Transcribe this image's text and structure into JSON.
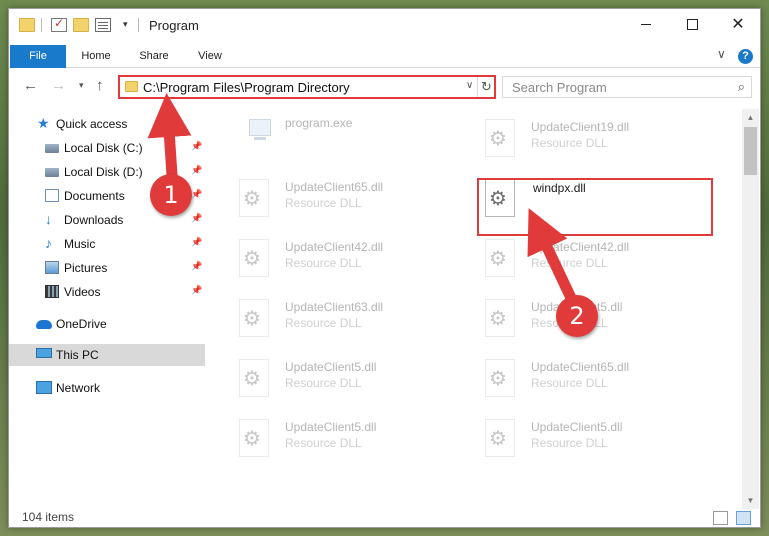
{
  "titlebar": {
    "title": "Program",
    "window_controls": [
      "minimize",
      "maximize",
      "close"
    ],
    "close_glyph": "✕"
  },
  "ribbon": {
    "tabs": [
      "File",
      "Home",
      "Share",
      "View"
    ],
    "help_glyph": "?",
    "expand_glyph": "∨"
  },
  "nav": {
    "back": "←",
    "forward": "→",
    "recent": "▾",
    "up": "↑",
    "address_path": "C:\\Program Files\\Program Directory",
    "address_dropdown": "∨",
    "refresh_glyph": "↻",
    "search_placeholder": "Search Program",
    "search_glyph": "⌕"
  },
  "sidebar": {
    "items": [
      {
        "label": "Quick access",
        "icon": "star-icon",
        "pinned": false
      },
      {
        "label": "Local Disk (C:)",
        "icon": "drive-icon",
        "pinned": true
      },
      {
        "label": "Local Disk (D:)",
        "icon": "drive-icon",
        "pinned": true
      },
      {
        "label": "Documents",
        "icon": "documents-icon",
        "pinned": true
      },
      {
        "label": "Downloads",
        "icon": "download-arrow-icon",
        "pinned": true
      },
      {
        "label": "Music",
        "icon": "music-note-icon",
        "pinned": true
      },
      {
        "label": "Pictures",
        "icon": "pictures-icon",
        "pinned": true
      },
      {
        "label": "Videos",
        "icon": "film-strip-icon",
        "pinned": true
      },
      {
        "label": "OneDrive",
        "icon": "cloud-icon",
        "pinned": false
      },
      {
        "label": "This PC",
        "icon": "computer-icon",
        "pinned": false,
        "selected": true
      },
      {
        "label": "Network",
        "icon": "network-icon",
        "pinned": false
      }
    ],
    "pin_glyph": "📌"
  },
  "files": [
    {
      "name": "program.exe",
      "type": "",
      "icon": "application-icon"
    },
    {
      "name": "UpdateClient19.dll",
      "type": "Resource DLL",
      "icon": "dll-gear-icon"
    },
    {
      "name": "UpdateClient65.dll",
      "type": "Resource DLL",
      "icon": "dll-gear-icon"
    },
    {
      "name": "windpx.dll",
      "type": "",
      "icon": "dll-gear-icon",
      "highlighted": true
    },
    {
      "name": "UpdateClient42.dll",
      "type": "Resource DLL",
      "icon": "dll-gear-icon"
    },
    {
      "name": "UpdateClient42.dll",
      "type": "Resource DLL",
      "icon": "dll-gear-icon"
    },
    {
      "name": "UpdateClient63.dll",
      "type": "Resource DLL",
      "icon": "dll-gear-icon"
    },
    {
      "name": "UpdateClient5.dll",
      "type": "Resource DLL",
      "icon": "dll-gear-icon"
    },
    {
      "name": "UpdateClient5.dll",
      "type": "Resource DLL",
      "icon": "dll-gear-icon"
    },
    {
      "name": "UpdateClient65.dll",
      "type": "Resource DLL",
      "icon": "dll-gear-icon"
    },
    {
      "name": "UpdateClient5.dll",
      "type": "Resource DLL",
      "icon": "dll-gear-icon"
    },
    {
      "name": "UpdateClient5.dll",
      "type": "Resource DLL",
      "icon": "dll-gear-icon"
    }
  ],
  "gear_glyph": "⚙",
  "scrollbar": {
    "up": "▲",
    "down": "▼"
  },
  "status": {
    "item_count": "104 items"
  },
  "annotations": {
    "step1": "1",
    "step2": "2",
    "color": "#e03a3a"
  },
  "colors": {
    "accent": "#1979ca",
    "highlight": "#e03a3a",
    "selected_bg": "#d9d9d9"
  }
}
